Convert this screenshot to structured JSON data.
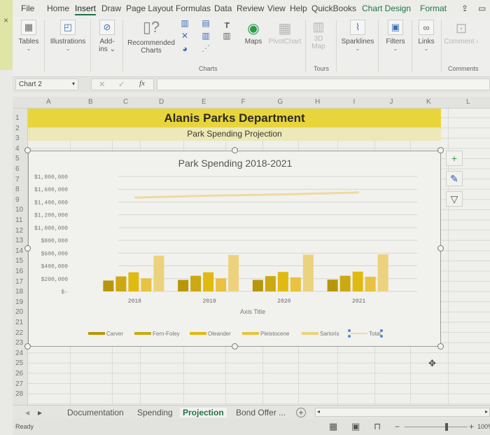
{
  "menu": {
    "tabs": [
      "File",
      "Home",
      "Insert",
      "Draw",
      "Page Layout",
      "Formulas",
      "Data",
      "Review",
      "View",
      "Help",
      "QuickBooks",
      "Chart Design",
      "Format"
    ],
    "active": "Insert"
  },
  "ribbon": {
    "tables": "Tables",
    "illustrations": "Illustrations",
    "addins_1": "Add-",
    "addins_2": "ins",
    "recommended_1": "Recommended",
    "recommended_2": "Charts",
    "charts_group": "Charts",
    "maps": "Maps",
    "pivotchart": "PivotChart",
    "map3d_1": "3D",
    "map3d_2": "Map",
    "tours_group": "Tours",
    "sparklines": "Sparklines",
    "filters": "Filters",
    "links": "Links",
    "comment": "Comment",
    "comments_group": "Comments"
  },
  "formula_bar": {
    "name_box": "Chart 2",
    "fx": "fx",
    "value": ""
  },
  "grid": {
    "columns": [
      "A",
      "B",
      "C",
      "D",
      "E",
      "F",
      "G",
      "H",
      "I",
      "J",
      "K",
      "L"
    ],
    "rows": [
      "1",
      "2",
      "3",
      "4",
      "5",
      "6",
      "7",
      "8",
      "9",
      "10",
      "11",
      "12",
      "13",
      "14",
      "15",
      "16",
      "17",
      "18",
      "19",
      "20",
      "21",
      "22",
      "23",
      "24",
      "25",
      "26",
      "27",
      "28"
    ],
    "title": "Alanis Parks Department",
    "subtitle": "Park Spending Projection",
    "colors": {
      "title_fill": "#e8d53c",
      "subtitle_fill": "#ece8b8"
    }
  },
  "chart_data": {
    "type": "bar",
    "title": "Park Spending 2018-2021",
    "xlabel": "Axis Title",
    "ylabel": "",
    "categories": [
      "2018",
      "2019",
      "2020",
      "2021"
    ],
    "ylim": [
      0,
      1800000
    ],
    "yticks": [
      "$-",
      "$200,000",
      "$400,000",
      "$600,000",
      "$800,000",
      "$1,000,000",
      "$1,200,000",
      "$1,400,000",
      "$1,600,000",
      "$1,800,000"
    ],
    "grid": true,
    "legend_position": "bottom",
    "series": [
      {
        "name": "Carver",
        "color": "#b8960a",
        "values": [
          170000,
          180000,
          180000,
          185000
        ]
      },
      {
        "name": "Fern-Foley",
        "color": "#cca812",
        "values": [
          235000,
          245000,
          240000,
          245000
        ]
      },
      {
        "name": "Oleander",
        "color": "#e0ba10",
        "values": [
          300000,
          300000,
          305000,
          310000
        ]
      },
      {
        "name": "Pleistocene",
        "color": "#e8c240",
        "values": [
          205000,
          205000,
          220000,
          230000
        ]
      },
      {
        "name": "Sartoris",
        "color": "#ecd27c",
        "values": [
          560000,
          570000,
          575000,
          580000
        ]
      },
      {
        "name": "Total",
        "color": "#efd9a0",
        "type": "line",
        "values": [
          1470000,
          1500000,
          1520000,
          1550000
        ]
      }
    ]
  },
  "side_tools": [
    "chart-elements",
    "chart-styles",
    "chart-filters"
  ],
  "sheets": {
    "tabs": [
      "Documentation",
      "Spending",
      "Projection",
      "Bond Offer ..."
    ],
    "active": "Projection"
  },
  "status": {
    "ready": "Ready",
    "zoom": "100%",
    "zoom_percent": 100
  }
}
